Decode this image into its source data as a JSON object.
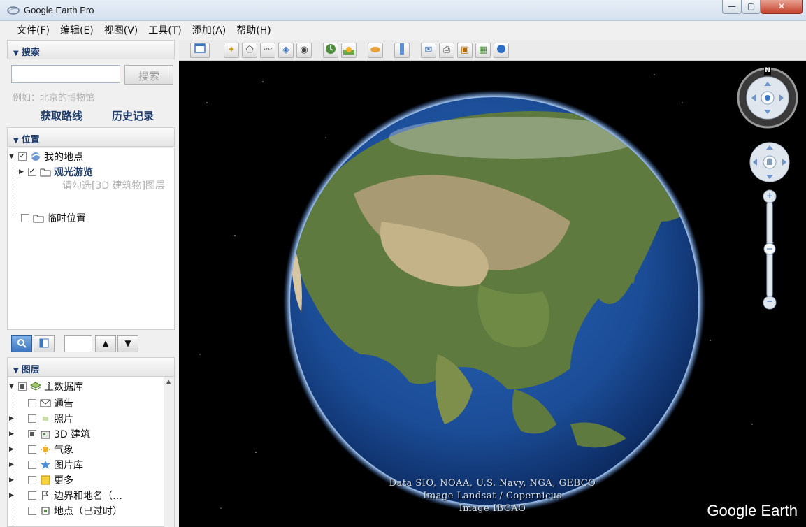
{
  "window": {
    "title": "Google Earth Pro",
    "minimize": "—",
    "maximize": "▢",
    "close": "✕"
  },
  "menu": [
    {
      "label": "文件(F)"
    },
    {
      "label": "编辑(E)"
    },
    {
      "label": "视图(V)"
    },
    {
      "label": "工具(T)"
    },
    {
      "label": "添加(A)"
    },
    {
      "label": "帮助(H)"
    }
  ],
  "search": {
    "header": "搜索",
    "input_value": "",
    "button": "搜索",
    "example": "例如：北京的博物馆",
    "get_directions": "获取路线",
    "history": "历史记录"
  },
  "places": {
    "header": "位置",
    "my_places": "我的地点",
    "sightseeing": "观光游览",
    "tour_hint": "请勾选[3D 建筑物]图层",
    "temporary": "临时位置"
  },
  "layers": {
    "header": "图层",
    "primary_db": "主数据库",
    "items": [
      {
        "label": "通告"
      },
      {
        "label": "照片"
      },
      {
        "label": "3D 建筑"
      },
      {
        "label": "气象"
      },
      {
        "label": "图片库"
      },
      {
        "label": "更多"
      },
      {
        "label": "边界和地名（…"
      },
      {
        "label": "地点（已过时）"
      }
    ]
  },
  "viewer": {
    "attribution": [
      "Data SIO, NOAA, U.S. Navy, NGA, GEBCO",
      "Image Landsat / Copernicus",
      "Image IBCAO"
    ],
    "brand": "Google Earth",
    "north": "N",
    "zoom_in": "+",
    "zoom_out": "−"
  },
  "colors": {
    "accent": "#1f3d6b",
    "ocean": "#1d4f9a",
    "space": "#000000"
  }
}
